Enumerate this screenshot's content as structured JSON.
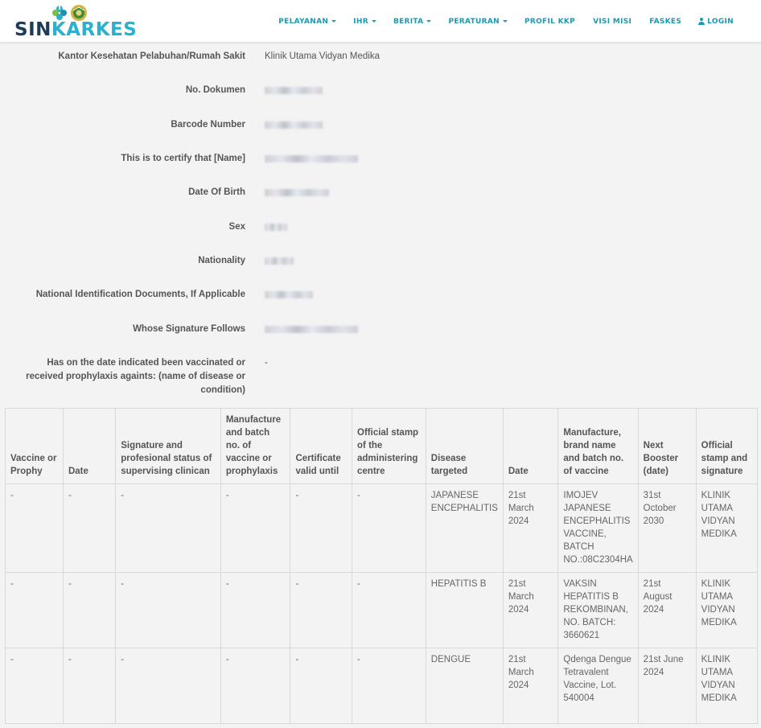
{
  "brand": {
    "logo_sin": "SIN",
    "logo_karkes": "KARKES"
  },
  "nav": [
    {
      "label": "PELAYANAN",
      "dropdown": true
    },
    {
      "label": "IHR",
      "dropdown": true
    },
    {
      "label": "BERITA",
      "dropdown": true
    },
    {
      "label": "PERATURAN",
      "dropdown": true
    },
    {
      "label": "PROFIL KKP",
      "dropdown": false
    },
    {
      "label": "VISI MISI",
      "dropdown": false
    },
    {
      "label": "FASKES",
      "dropdown": false
    },
    {
      "label": "LOGIN",
      "dropdown": false,
      "icon": "user-icon"
    }
  ],
  "certificate": {
    "kantor_label": "Kantor Kesehatan Pelabuhan/Rumah Sakit",
    "kantor_value": "Klinik Utama Vidyan Medika",
    "dokumen_label": "No. Dokumen",
    "barcode_label": "Barcode Number",
    "certify_label": "This is to certify that [Name]",
    "dob_label": "Date Of Birth",
    "sex_label": "Sex",
    "nationality_label": "Nationality",
    "nid_label": "National Identification Documents, If Applicable",
    "signature_label": "Whose Signature Follows",
    "vaccinated_label": "Has on the date indicated been vaccinated or received prophylaxis againts: (name of disease or condition)",
    "vaccinated_value": "-"
  },
  "table": {
    "headers": [
      "Vaccine or Prophy",
      "Date",
      "Signature and profesional status of supervising clinican",
      "Manufacture and batch no. of vaccine or prophylaxis",
      "Certificate valid until",
      "Official stamp of the administering centre",
      "Disease targeted",
      "Date",
      "Manufacture, brand name and batch no. of vaccine",
      "Next Booster (date)",
      "Official stamp and signature"
    ],
    "rows": [
      [
        "-",
        "-",
        "-",
        "-",
        "-",
        "-",
        "JAPANESE ENCEPHALITIS",
        "21st March 2024",
        "IMOJEV JAPANESE ENCEPHALITIS VACCINE, BATCH NO.:08C2304HA",
        "31st October 2030",
        "KLINIK UTAMA VIDYAN MEDIKA"
      ],
      [
        "-",
        "-",
        "-",
        "-",
        "-",
        "-",
        "HEPATITIS B",
        "21st March 2024",
        "VAKSIN HEPATITIS B REKOMBINAN, NO. BATCH: 3660621",
        "21st August 2024",
        "KLINIK UTAMA VIDYAN MEDIKA"
      ],
      [
        "-",
        "-",
        "-",
        "-",
        "-",
        "-",
        "DENGUE",
        "21st March 2024",
        "Qdenga Dengue Tetravalent Vaccine, Lot. 540004",
        "21st June 2024",
        "KLINIK UTAMA VIDYAN MEDIKA"
      ]
    ]
  },
  "colors": {
    "brand_dark": "#1c3c5a",
    "brand_accent": "#2bb0d0",
    "nav_text": "#1a9ab5",
    "page_bg": "#f3f3f3"
  }
}
